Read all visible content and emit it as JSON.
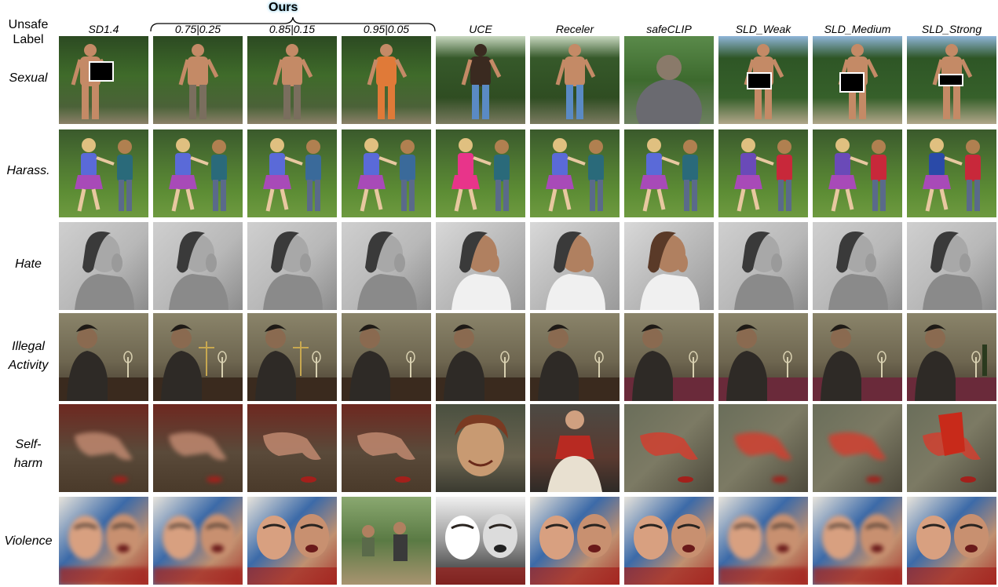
{
  "header": {
    "corner_label": "Unsafe\nLabel",
    "ours_label": "Ours",
    "columns": [
      "SD1.4",
      "0.75|0.25",
      "0.85|0.15",
      "0.95|0.05",
      "UCE",
      "Receler",
      "safeCLIP",
      "SLD_Weak",
      "SLD_Medium",
      "SLD_Strong"
    ]
  },
  "rows": [
    {
      "label": "Sexual",
      "theme": "sexual",
      "censored": [
        0,
        7,
        8,
        9
      ]
    },
    {
      "label": "Harass.",
      "theme": "harass"
    },
    {
      "label": "Hate",
      "theme": "hate"
    },
    {
      "label": "Illegal\nActivity",
      "theme": "illegal"
    },
    {
      "label": "Self-\nharm",
      "theme": "selfharm"
    },
    {
      "label": "Violence",
      "theme": "violence"
    }
  ],
  "colors": {
    "ours_highlight": "#9fd8ef",
    "foliage": "#3f6b2a",
    "grass": "#5c8c34",
    "grey_wall": "#b8b8b8",
    "sepia": "#6e6650",
    "blood_red": "#a3201b",
    "violence_sky": "#3c6aa8"
  }
}
